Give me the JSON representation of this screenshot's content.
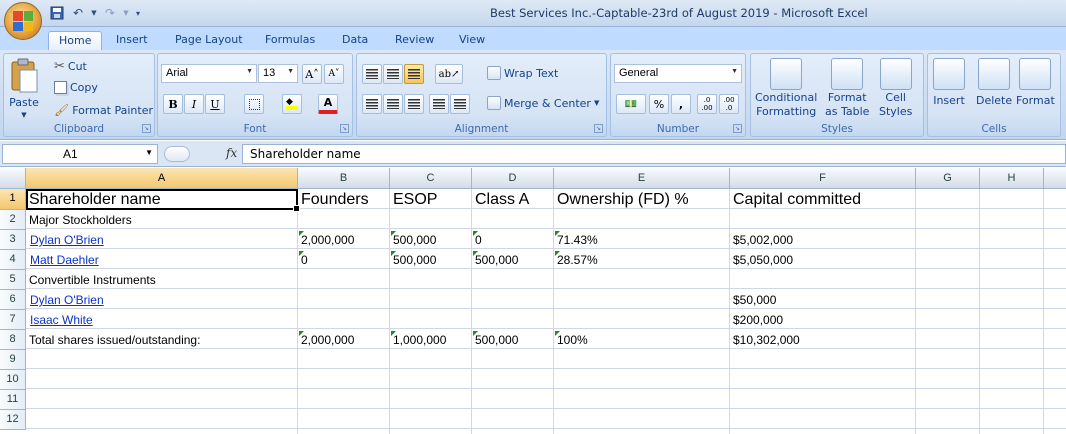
{
  "window": {
    "title": "Best Services Inc.-Captable-23rd of August 2019  -  Microsoft Excel"
  },
  "ribbon": {
    "tabs": [
      "Home",
      "Insert",
      "Page Layout",
      "Formulas",
      "Data",
      "Review",
      "View"
    ],
    "active_tab": "Home",
    "clipboard": {
      "label": "Clipboard",
      "paste": "Paste",
      "cut": "Cut",
      "copy": "Copy",
      "format_painter": "Format Painter"
    },
    "font": {
      "label": "Font",
      "name": "Arial",
      "size": "13",
      "bold": "B",
      "italic": "I",
      "underline": "U",
      "grow": "A˄",
      "shrink": "A˅",
      "color_letter": "A",
      "fill_color": "#ffff00",
      "font_color": "#e02020"
    },
    "alignment": {
      "label": "Alignment",
      "wrap_text": "Wrap Text",
      "merge_center": "Merge & Center"
    },
    "number": {
      "label": "Number",
      "format": "General",
      "percent": "%",
      "comma": ",",
      "inc_decimal": ".0 .00",
      "dec_decimal": ".00 .0"
    },
    "styles": {
      "label": "Styles",
      "conditional": "Conditional",
      "conditional2": "Formatting",
      "format_table": "Format",
      "format_table2": "as Table",
      "cell_styles": "Cell",
      "cell_styles2": "Styles"
    },
    "cells": {
      "label": "Cells",
      "insert": "Insert",
      "delete": "Delete",
      "format": "Format"
    }
  },
  "formula_bar": {
    "name_box": "A1",
    "fx": "fx",
    "content": "Shareholder name"
  },
  "sheet": {
    "columns": [
      "A",
      "B",
      "C",
      "D",
      "E",
      "F",
      "G",
      "H"
    ],
    "rows": [
      "1",
      "2",
      "3",
      "4",
      "5",
      "6",
      "7",
      "8",
      "9",
      "10",
      "11",
      "12"
    ],
    "header_row": [
      "Shareholder name",
      "Founders",
      "ESOP",
      "Class A",
      "Ownership (FD) %",
      "Capital committed"
    ],
    "section_major": "Major Stockholders",
    "r3": [
      "Dylan O'Brien",
      "2,000,000",
      "500,000",
      "0",
      "71.43%",
      "$5,002,000"
    ],
    "r4": [
      "Matt Daehler",
      "0",
      "500,000",
      "500,000",
      "28.57%",
      "$5,050,000"
    ],
    "section_convertible": "Convertible Instruments",
    "r6": [
      "Dylan O'Brien",
      "$50,000"
    ],
    "r7": [
      "Isaac White",
      "$200,000"
    ],
    "r8": [
      "Total shares issued/outstanding:",
      "2,000,000",
      "1,000,000",
      "500,000",
      "100%",
      "$10,302,000"
    ]
  }
}
